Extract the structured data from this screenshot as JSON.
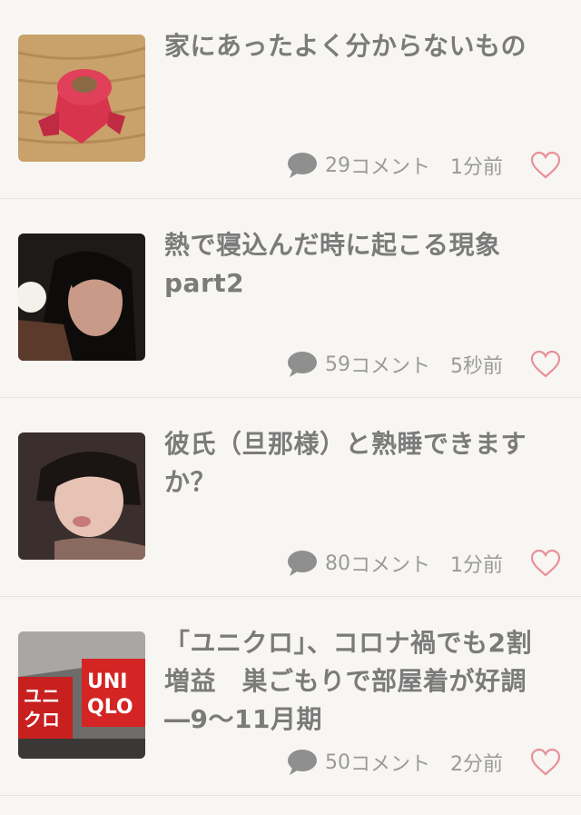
{
  "items": [
    {
      "title": "家にあったよく分からないもの",
      "comments": "29",
      "comment_label": "コメント",
      "time": "1分前",
      "thumb": "red-plastic-nut-photo"
    },
    {
      "title": "熱で寝込んだ時に起こる現象part2",
      "comments": "59",
      "comment_label": "コメント",
      "time": "5秒前",
      "thumb": "sleeping-person-photo"
    },
    {
      "title": "彼氏（旦那様）と熟睡できますか？",
      "comments": "80",
      "comment_label": "コメント",
      "time": "1分前",
      "thumb": "sleeping-person-photo"
    },
    {
      "title": "「ユニクロ」、コロナ禍でも2割増益　巣ごもりで部屋着が好調―9～11月期",
      "comments": "50",
      "comment_label": "コメント",
      "time": "2分前",
      "thumb": "uniqlo-sign-photo"
    }
  ],
  "thumb_texts": {
    "uniqlo_left": "ユニ",
    "uniqlo_left2": "クロ",
    "uniqlo_right": "UNI",
    "uniqlo_right2": "QLO"
  },
  "colors": {
    "background": "#f8f6f2",
    "heart": "#e8909a",
    "text": "#7b7b7b",
    "meta": "#9a9a9a"
  },
  "icons": [
    "comment-bubble-icon",
    "heart-outline-icon"
  ]
}
